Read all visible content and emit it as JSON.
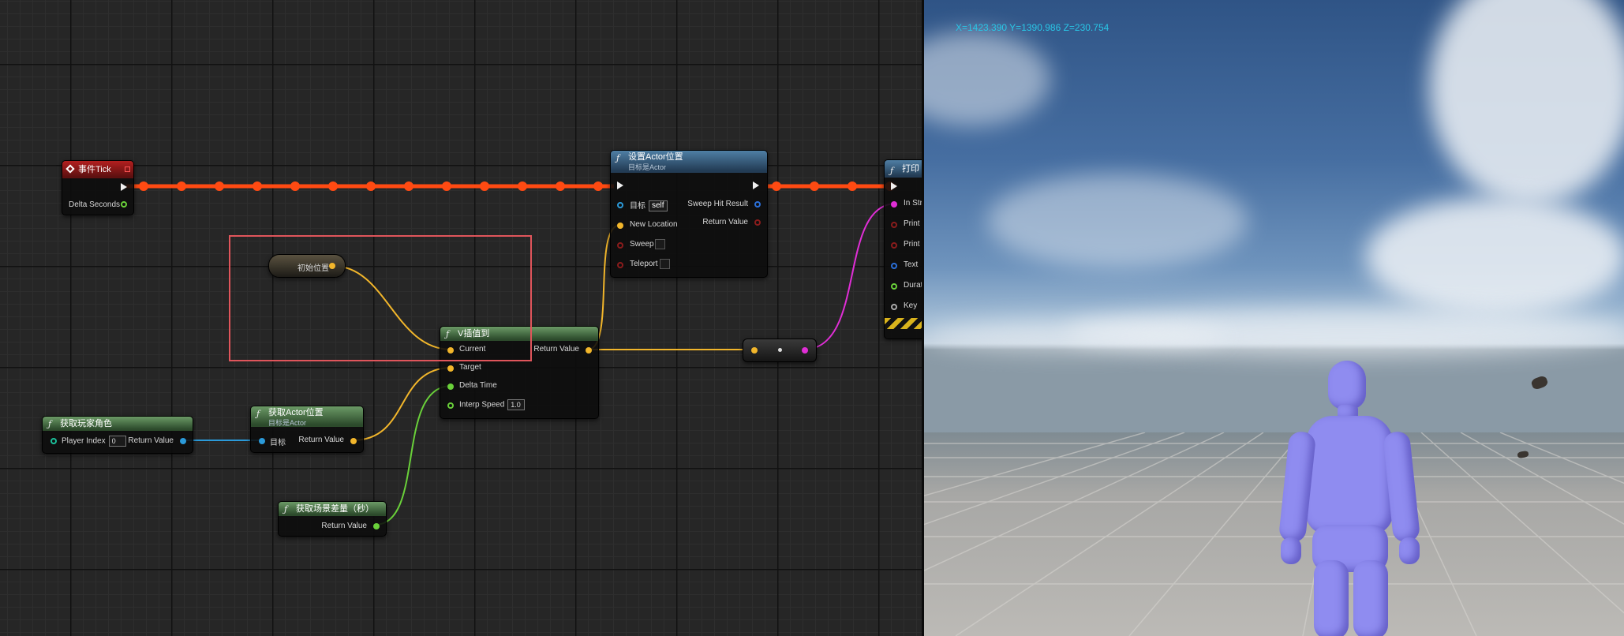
{
  "graph": {
    "event_tick": {
      "title": "事件Tick",
      "delta_seconds": "Delta Seconds"
    },
    "set_actor_location": {
      "title": "设置Actor位置",
      "subtitle": "目标是Actor",
      "target_label": "目标",
      "target_value": "self",
      "new_location": "New Location",
      "sweep": "Sweep",
      "teleport": "Teleport",
      "sweep_hit_result": "Sweep Hit Result",
      "return_value": "Return Value"
    },
    "print_node": {
      "title": "打印",
      "pins": [
        "In Str",
        "Print",
        "Print",
        "Text",
        "Durat",
        "Key"
      ]
    },
    "initial_position": {
      "label": "初始位置"
    },
    "vinterp": {
      "title": "V插值到",
      "current": "Current",
      "target": "Target",
      "delta_time": "Delta Time",
      "interp_speed": "Interp Speed",
      "interp_speed_value": "1.0",
      "return_value": "Return Value"
    },
    "get_player_character": {
      "title": "获取玩家角色",
      "player_index": "Player Index",
      "player_index_value": "0",
      "return_value": "Return Value"
    },
    "get_actor_location": {
      "title": "获取Actor位置",
      "subtitle": "目标是Actor",
      "target_label": "目标",
      "return_value": "Return Value"
    },
    "get_game_time": {
      "title": "获取场景差量（秒）",
      "return_value": "Return Value"
    }
  },
  "viewport": {
    "coords": "X=1423.390 Y=1390.986 Z=230.754"
  },
  "colors": {
    "exec_wire": "#ff4a12",
    "vector_wire": "#f2b62b",
    "float_wire": "#6ad13a",
    "object_wire": "#2b9ad9",
    "string_wire": "#e02ed6",
    "selection": "#e0555b",
    "coords_text": "#29c6e6"
  }
}
